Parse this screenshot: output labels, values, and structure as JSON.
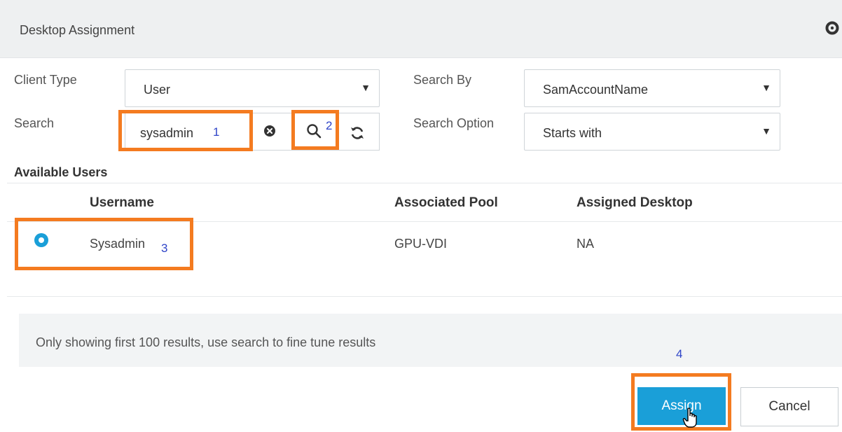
{
  "header": {
    "title": "Desktop Assignment",
    "settings_icon": "gear-icon"
  },
  "form": {
    "client_type": {
      "label": "Client Type",
      "value": "User"
    },
    "search_by": {
      "label": "Search By",
      "value": "SamAccountName"
    },
    "search": {
      "label": "Search",
      "value": "sysadmin"
    },
    "search_option": {
      "label": "Search Option",
      "value": "Starts with"
    },
    "icons": {
      "clear": "clear-circle-icon",
      "search": "magnifier-icon",
      "refresh": "refresh-icon"
    }
  },
  "available_users": {
    "title": "Available Users",
    "columns": [
      "Username",
      "Associated Pool",
      "Assigned Desktop"
    ],
    "rows": [
      {
        "username": "Sysadmin",
        "pool": "GPU-VDI",
        "desktop": "NA",
        "selected": true
      }
    ]
  },
  "footer": {
    "note": "Only showing first 100 results, use search to fine tune results",
    "assign_label": "Assign",
    "cancel_label": "Cancel"
  },
  "annotations": {
    "step1": "1",
    "step2": "2",
    "step3": "3",
    "step4": "4"
  },
  "colors": {
    "accent": "#1a9fd8",
    "highlight": "#f47b20",
    "annotation": "#2f44c8"
  }
}
